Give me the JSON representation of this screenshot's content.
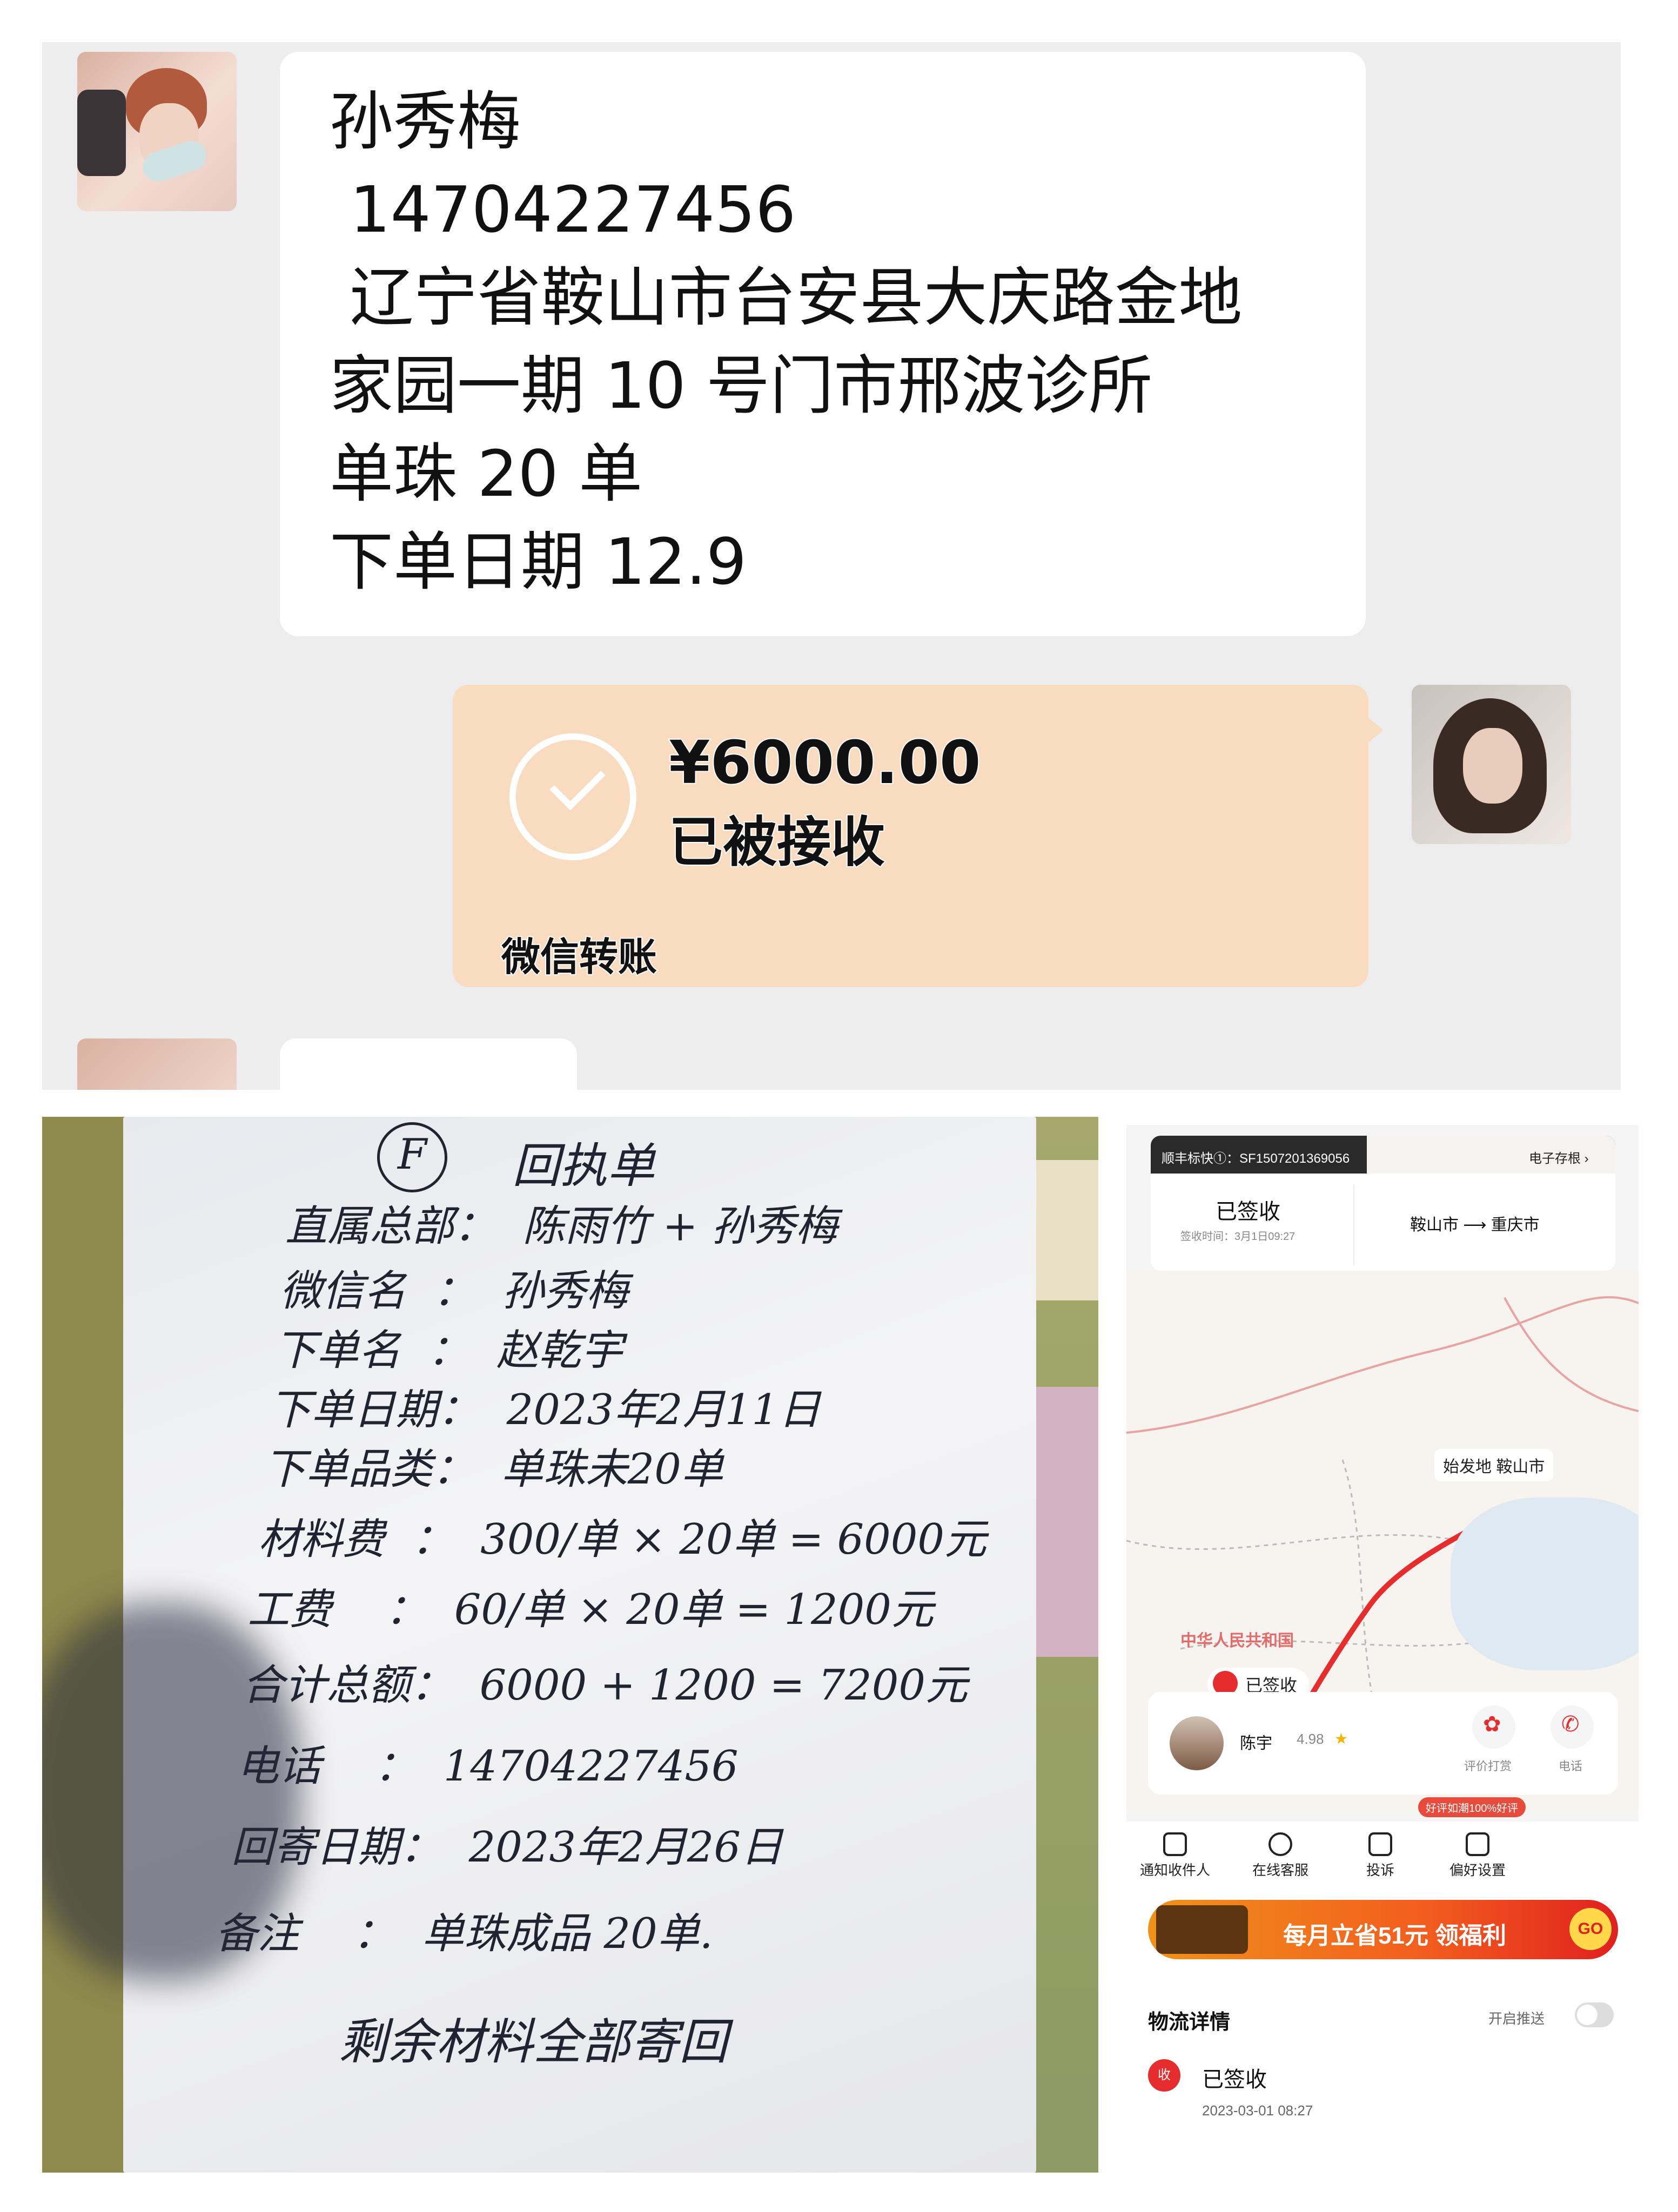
{
  "chat": {
    "message_lines": [
      "孙秀梅",
      " 14704227456",
      " 辽宁省鞍山市台安县大庆路金地",
      "家园一期 10 号门市邢波诊所",
      "单珠 20 单",
      "下单日期 12.9"
    ],
    "transfer": {
      "amount": "¥6000.00",
      "status": "已被接收",
      "type_label": "微信转账"
    }
  },
  "note": {
    "circle_letter": "F",
    "title": "回执单",
    "lines": [
      "直属总部：  陈雨竹 + 孙秀梅",
      "微信名  ：  孙秀梅",
      "下单名  ：  赵乾宇",
      "下单日期：  2023年2月11日",
      "下单品类：  单珠未20单",
      "材料费  ：  300/单 × 20单 = 6000元",
      "工费    ：  60/单 × 20单 = 1200元",
      "合计总额：  6000 + 1200 = 7200元",
      "电话    ：  14704227456",
      "回寄日期：  2023年2月26日",
      "备注    ：  单珠成品 20单.",
      "        剩余材料全部寄回"
    ]
  },
  "phone": {
    "tracking": "顺丰标快①：SF1507201369056",
    "e_receipt": "电子存根",
    "signed_status": "已签收",
    "sign_time": "签收时间：3月1日09:27",
    "route_from": "鞍山市",
    "route_to": "重庆市",
    "map_origin_tag": "始发地",
    "map_origin_city": "鞍山市",
    "map_country": "中华人民共和国",
    "map_signed": "已签收",
    "courier_name": "陈宇",
    "courier_score": "4.98",
    "action_rate": "评价打赏",
    "action_call": "电话",
    "badge": "好评如潮100%好评",
    "functions": [
      "通知收件人",
      "在线客服",
      "投诉",
      "偏好设置"
    ],
    "promo_text": "每月立省51元 领福利",
    "promo_go": "GO",
    "logistics_title": "物流详情",
    "push_label": "开启推送",
    "recv_icon_text": "收",
    "detail_status": "已签收",
    "detail_date": "2023-03-01 08:27"
  }
}
